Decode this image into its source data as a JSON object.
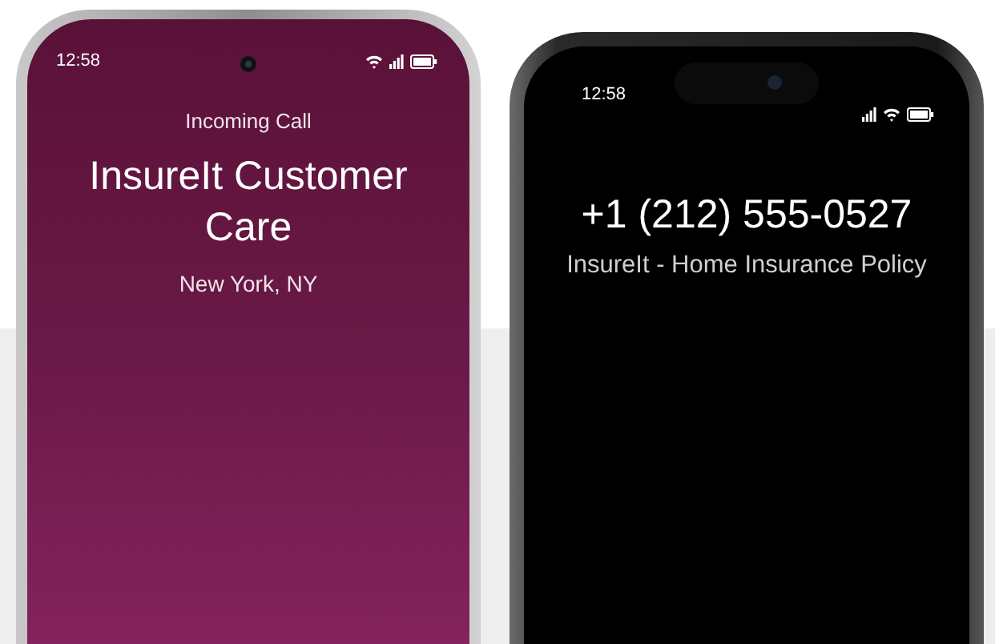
{
  "phones": [
    {
      "kind": "android",
      "time": "12:58",
      "label": "Incoming Call",
      "title": "InsureIt Customer Care",
      "subtitle": "New York, NY"
    },
    {
      "kind": "iphone",
      "time": "12:58",
      "title": "+1 (212) 555-0527",
      "subtitle": "InsureIt - Home Insurance Policy"
    }
  ]
}
